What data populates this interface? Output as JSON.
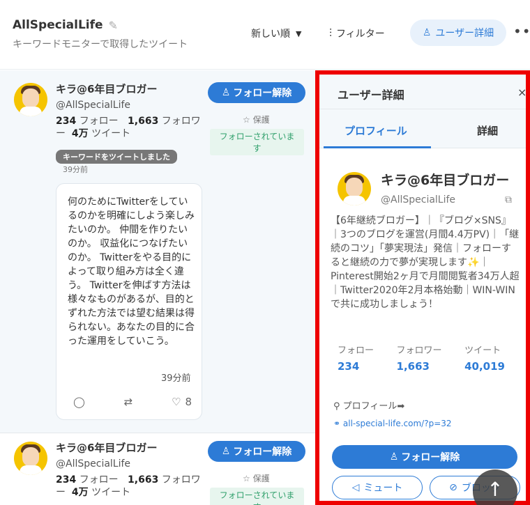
{
  "header": {
    "title": "AllSpecialLife",
    "subtitle": "キーワードモニターで取得したツイート",
    "sort_label": "新しい順",
    "filter_label": "フィルター",
    "user_detail_label": "ユーザー詳細",
    "more_icon": "•••"
  },
  "tweets": [
    {
      "name": "キラ@6年目ブロガー",
      "handle": "@AllSpecialLife",
      "following_count": "234",
      "following_label": "フォロー",
      "followers_count": "1,663",
      "followers_label": "フォロワー",
      "tweets_count": "4万",
      "tweets_label": "ツイート",
      "unfollow_label": "フォロー解除",
      "protected_label": "保護",
      "followed_badge": "フォローされています",
      "keyword_tag": "キーワードをツイートしました",
      "time": "39分前",
      "body": "何のためにTwitterをしているのかを明確にしよう楽しみたいのか。 仲間を作りたいのか。 収益化につなげたいのか。 Twitterをやる目的によって取り組み方は全く違う。 Twitterを伸ばす方法は様々なものがあるが、目的とずれた方法では望む結果は得られない。あなたの目的に合った運用をしていこう。",
      "card_time": "39分前",
      "likes": "8"
    },
    {
      "name": "キラ@6年目ブロガー",
      "handle": "@AllSpecialLife",
      "following_count": "234",
      "following_label": "フォロー",
      "followers_count": "1,663",
      "followers_label": "フォロワー",
      "tweets_count": "4万",
      "tweets_label": "ツイート",
      "unfollow_label": "フォロー解除",
      "protected_label": "保護",
      "followed_badge": "フォローされています"
    }
  ],
  "panel": {
    "title": "ユーザー詳細",
    "close": "×",
    "tabs": [
      "プロフィール",
      "詳細"
    ],
    "name": "キラ@6年目ブロガー",
    "handle": "@AllSpecialLife",
    "bio_before": "【6年継続ブロガー】｜『ブログ×SNS』｜3つのブログを運営(月間4.4万PV)｜「継続のコツ」「夢実現法」発信｜フォローすると継続の力で夢が実現します",
    "bio_sparkle": "✨",
    "bio_after": "｜Pinterest開始2ヶ月で月間閲覧者34万人超｜Twitter2020年2月本格始動｜WIN-WINで共に成功しましょう！",
    "stats": [
      {
        "label": "フォロー",
        "value": "234"
      },
      {
        "label": "フォロワー",
        "value": "1,663"
      },
      {
        "label": "ツイート",
        "value": "40,019"
      }
    ],
    "profile_link_label": "プロフィール➡",
    "url": "all-special-life.com/?p=32",
    "unfollow_label": "フォロー解除",
    "mute_label": "ミュート",
    "block_label": "ブロック"
  },
  "colors": {
    "accent": "#2d7bd6",
    "highlight_border": "#ee0000",
    "avatar_bg": "#f5c400",
    "followed_green": "#2e9f6a"
  }
}
